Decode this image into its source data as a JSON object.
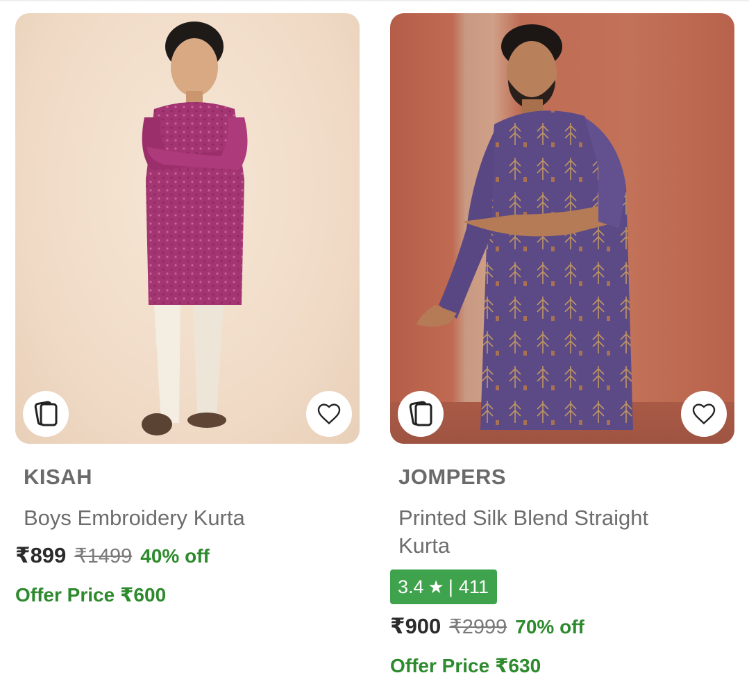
{
  "products": [
    {
      "brand": "KISAH",
      "title": "Boys Embroidery Kurta",
      "price": "₹899",
      "mrp": "₹1499",
      "discount": "40% off",
      "offer_price": "Offer Price ₹600",
      "icons": {
        "similar": "similar-products-icon",
        "wishlist": "heart-icon"
      }
    },
    {
      "brand": "JOMPERS",
      "title": "Printed Silk Blend Straight Kurta",
      "rating": {
        "score": "3.4",
        "separator": "|",
        "count": "411"
      },
      "price": "₹900",
      "mrp": "₹2999",
      "discount": "70% off",
      "offer_price": "Offer Price ₹630",
      "icons": {
        "similar": "similar-products-icon",
        "wishlist": "heart-icon"
      }
    }
  ],
  "colors": {
    "discount_green": "#2d8a2d",
    "rating_green": "#3fa34d",
    "brand_gray": "#6a6a6a"
  }
}
